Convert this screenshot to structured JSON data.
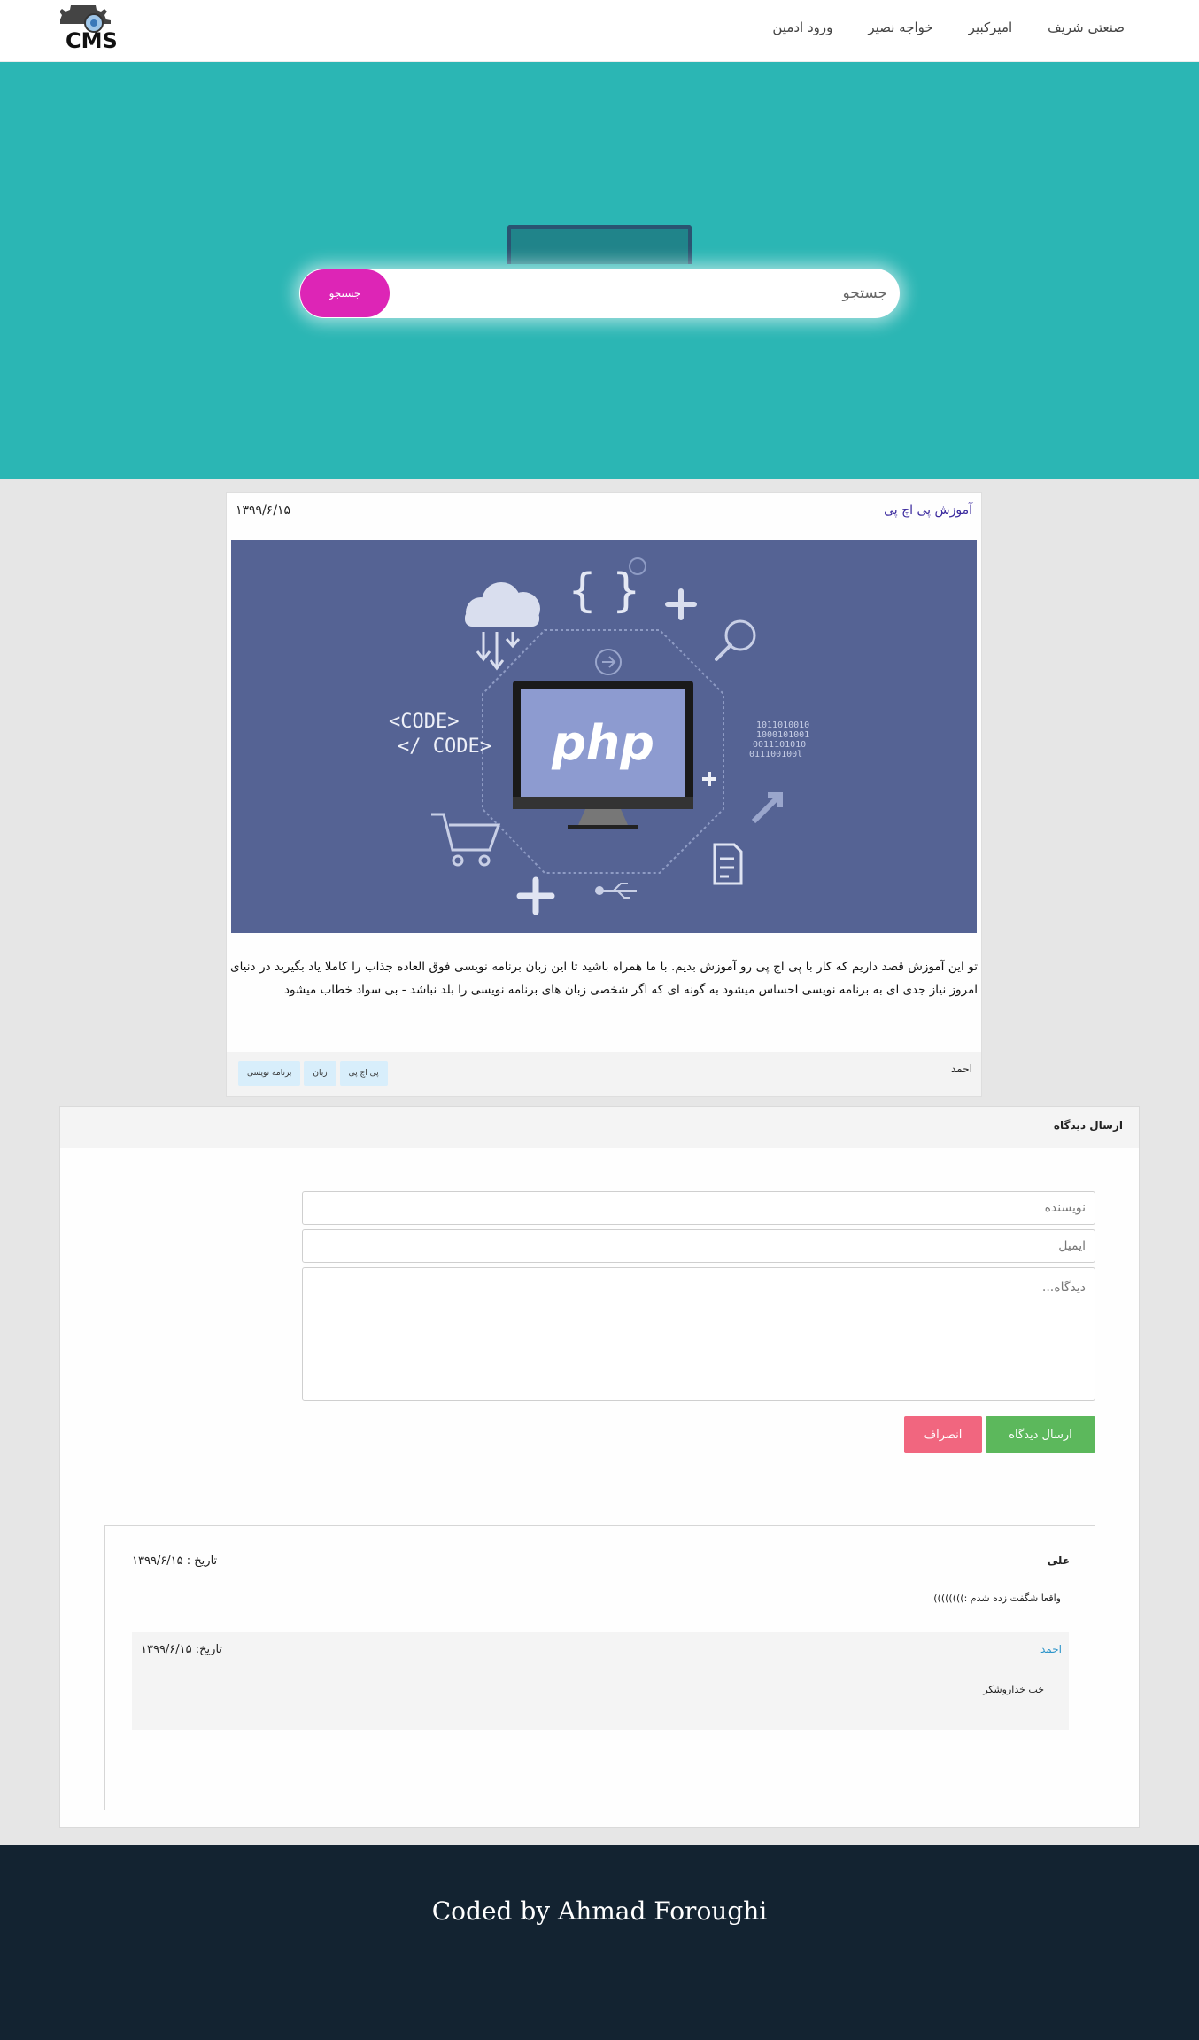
{
  "navbar": {
    "logo_text": "CMS",
    "links": [
      "صنعتی شریف",
      "امیرکبیر",
      "خواجه نصیر",
      "ورود ادمین"
    ]
  },
  "search": {
    "placeholder": "جستجو",
    "button_label": "جستجو"
  },
  "post": {
    "title": "آموزش پی اچ پی",
    "date": "۱۳۹۹/۶/۱۵",
    "image_label": "php",
    "body": "تو این آموزش قصد داریم که کار با پی اچ پی رو آموزش بدیم. با ما همراه باشید تا این زبان برنامه نویسی فوق العاده جذاب را کاملا یاد بگیرید در دنیای امروز نیاز جدی ای به برنامه نویسی احساس میشود به گونه ای که اگر شخصی زبان های برنامه نویسی را بلد نباشد - بی سواد خطاب میشود",
    "author": "احمد",
    "tags": [
      "پی اچ پی",
      "زبان",
      "برنامه نویسی"
    ]
  },
  "comment_form": {
    "title": "ارسال دیدگاه",
    "author_placeholder": "نویسنده",
    "email_placeholder": "ایمیل",
    "comment_placeholder": "دیدگاه...",
    "send_label": "ارسال دیدگاه",
    "cancel_label": "انصراف"
  },
  "comments": [
    {
      "author": "علی",
      "date": "تاریخ : ۱۳۹۹/۶/۱۵",
      "text": "واقعا شگفت زده شدم :))))))))",
      "reply": {
        "author": "احمد",
        "date": "تاریخ: ۱۳۹۹/۶/۱۵",
        "text": "خب خداروشکر"
      }
    }
  ],
  "footer": {
    "text": "Coded by Ahmad Foroughi"
  },
  "colors": {
    "hero_bg": "#2bb6b4",
    "search_button": "#dd25b6",
    "send_button": "#5cb85c",
    "cancel_button": "#f1667f",
    "footer_bg": "#132331",
    "post_title": "#3b2a9e",
    "tag_bg": "#d8eefb",
    "image_bg": "#556394"
  }
}
